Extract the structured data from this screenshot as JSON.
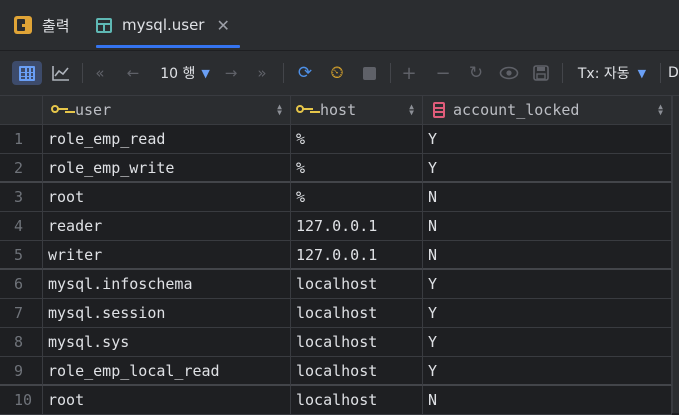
{
  "tabs": [
    {
      "label": "출력",
      "icon": "output-icon"
    },
    {
      "label": "mysql.user",
      "icon": "table-icon"
    }
  ],
  "toolbar": {
    "page_size": "10 행",
    "tx_mode": "Tx: 자동",
    "overflow_label": "D"
  },
  "table": {
    "columns": [
      {
        "label": "user",
        "icon": "key-icon"
      },
      {
        "label": "host",
        "icon": "key-icon"
      },
      {
        "label": "account_locked",
        "icon": "column-icon"
      }
    ],
    "rows": [
      {
        "num": "1",
        "user": "role_emp_read",
        "host": "%",
        "account_locked": "Y"
      },
      {
        "num": "2",
        "user": "role_emp_write",
        "host": "%",
        "account_locked": "Y"
      },
      {
        "num": "3",
        "user": "root",
        "host": "%",
        "account_locked": "N"
      },
      {
        "num": "4",
        "user": "reader",
        "host": "127.0.0.1",
        "account_locked": "N"
      },
      {
        "num": "5",
        "user": "writer",
        "host": "127.0.0.1",
        "account_locked": "N"
      },
      {
        "num": "6",
        "user": "mysql.infoschema",
        "host": "localhost",
        "account_locked": "Y"
      },
      {
        "num": "7",
        "user": "mysql.session",
        "host": "localhost",
        "account_locked": "Y"
      },
      {
        "num": "8",
        "user": "mysql.sys",
        "host": "localhost",
        "account_locked": "Y"
      },
      {
        "num": "9",
        "user": "role_emp_local_read",
        "host": "localhost",
        "account_locked": "Y"
      },
      {
        "num": "10",
        "user": "root",
        "host": "localhost",
        "account_locked": "N"
      }
    ]
  },
  "colors": {
    "accent": "#3574f0",
    "key": "#e6c64a",
    "column": "#e05c7a"
  }
}
